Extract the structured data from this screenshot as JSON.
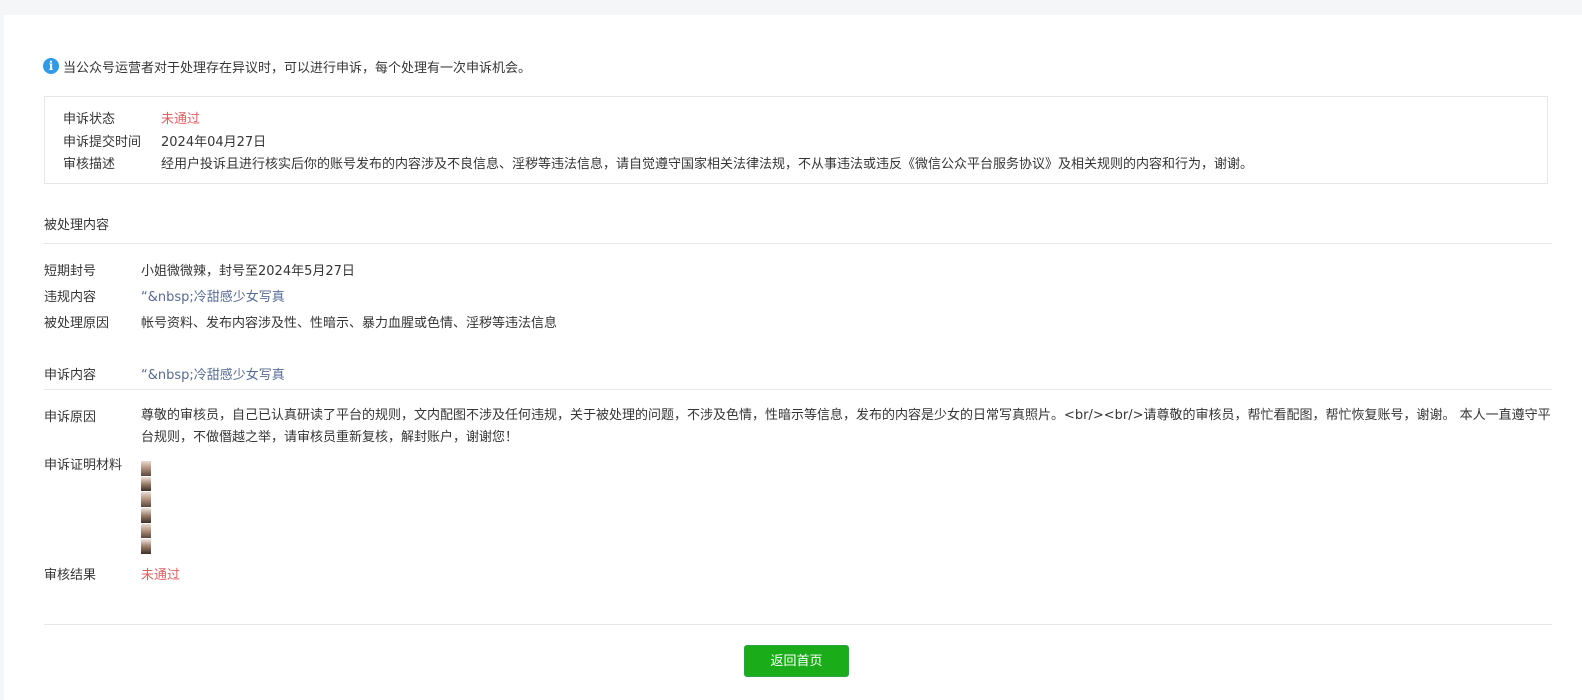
{
  "notice": {
    "icon": "info-icon",
    "text": "当公众号运营者对于处理存在异议时，可以进行申诉，每个处理有一次申诉机会。"
  },
  "appeal_status": {
    "status_label": "申诉状态",
    "status_value": "未通过",
    "submit_time_label": "申诉提交时间",
    "submit_time_value": "2024年04月27日",
    "review_desc_label": "审核描述",
    "review_desc_value": "经用户投诉且进行核实后你的账号发布的内容涉及不良信息、淫秽等违法信息，请自觉遵守国家相关法律法规，不从事违法或违反《微信公众平台服务协议》及相关规则的内容和行为，谢谢。"
  },
  "processed_content": {
    "section_title": "被处理内容",
    "ban_label": "短期封号",
    "ban_value": "小姐微微辣，封号至2024年5月27日",
    "violation_label": "违规内容",
    "violation_value": "“&nbsp;冷甜感少女写真",
    "reason_label": "被处理原因",
    "reason_value": "帐号资料、发布内容涉及性、性暗示、暴力血腥或色情、淫秽等违法信息"
  },
  "appeal_content": {
    "label": "申诉内容",
    "value": "“&nbsp;冷甜感少女写真",
    "reason_label": "申诉原因",
    "reason_value": "尊敬的审核员，自己已认真研读了平台的规则，文内配图不涉及任何违规，关于被处理的问题，不涉及色情，性暗示等信息，发布的内容是少女的日常写真照片。<br/><br/>请尊敬的审核员，帮忙看配图，帮忙恢复账号，谢谢。 本人一直遵守平台规则，不做僭越之举，请审核员重新复核，解封账户，谢谢您！",
    "evidence_label": "申诉证明材料",
    "result_label": "审核结果",
    "result_value": "未通过"
  },
  "footer": {
    "return_button": "返回首页"
  },
  "colors": {
    "rejected": "#e15f63",
    "link": "#576b95",
    "primary_button": "#1aad19",
    "info_icon": "#2e9ae8"
  }
}
